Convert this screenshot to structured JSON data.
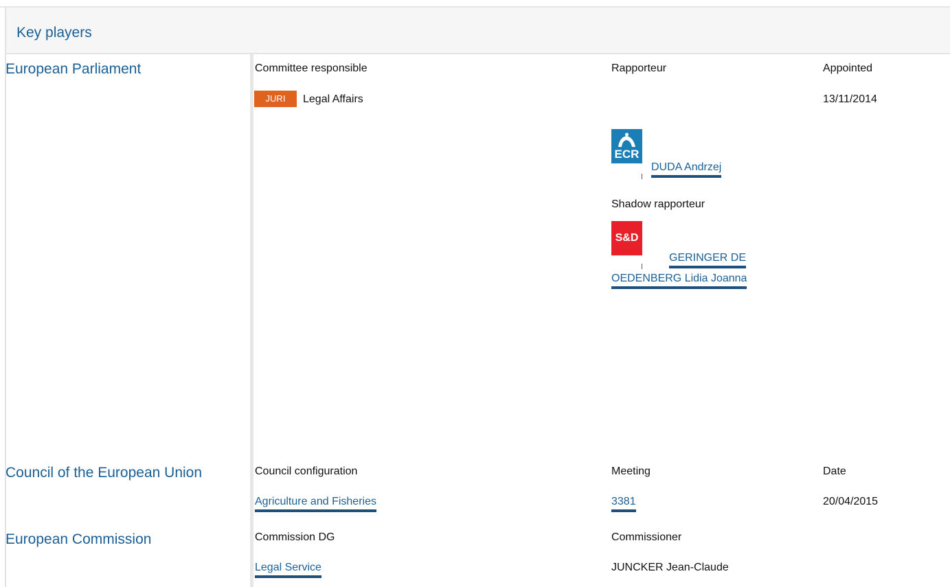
{
  "header": {
    "title": "Key players"
  },
  "parliament": {
    "name": "European Parliament",
    "col_committee": "Committee responsible",
    "col_rapporteur": "Rapporteur",
    "col_appointed": "Appointed",
    "committee_badge": "JURI",
    "committee_name": "Legal Affairs",
    "appointed_date": "13/11/2014",
    "rapporteur": {
      "group_logo": "ECR",
      "name": "DUDA Andrzej"
    },
    "shadow_label": "Shadow rapporteur",
    "shadow": {
      "group_logo": "S&D",
      "name_line1": "GERINGER DE",
      "name_line2": "OEDENBERG Lidia Joanna"
    }
  },
  "council": {
    "name": "Council of the European Union",
    "col_configuration": "Council configuration",
    "col_meeting": "Meeting",
    "col_date": "Date",
    "configuration": "Agriculture and Fisheries",
    "meeting": "3381",
    "date": "20/04/2015"
  },
  "commission": {
    "name": "European Commission",
    "col_dg": "Commission DG",
    "col_commissioner": "Commissioner",
    "dg": "Legal Service",
    "commissioner": "JUNCKER Jean-Claude"
  },
  "colors": {
    "link": "#1a5f96",
    "underline": "#1f4f7c",
    "badge": "#e0621f",
    "ecr": "#1b7fb5",
    "sd": "#e8202a"
  }
}
